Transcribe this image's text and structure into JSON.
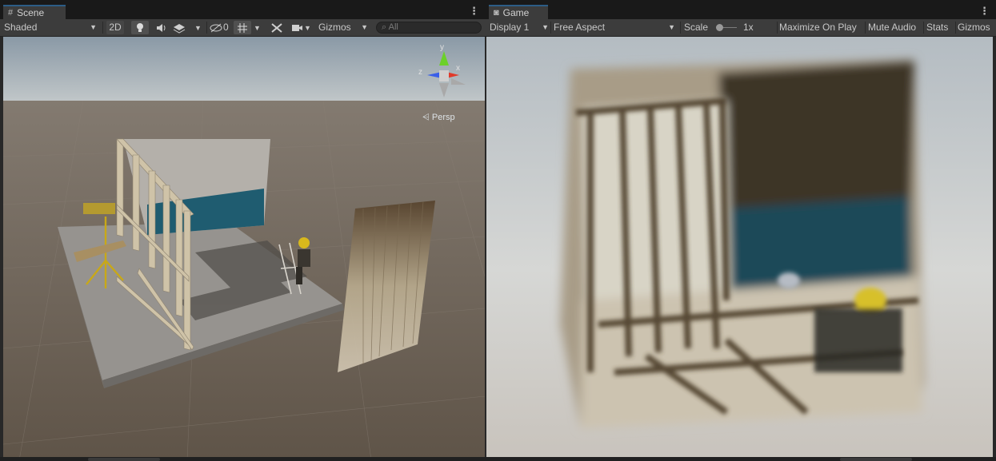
{
  "scene": {
    "tab_label": "Scene",
    "tab_icon": "grid-icon",
    "shading_mode": "Shaded",
    "mode_2d": "2D",
    "hidden_count": "0",
    "gizmos_label": "Gizmos",
    "search_placeholder": "All",
    "gizmo_axis_y": "y",
    "gizmo_axis_z": "z",
    "gizmo_axis_x": "x",
    "projection_label": "Persp"
  },
  "game": {
    "tab_label": "Game",
    "tab_icon": "gamepad-icon",
    "display": "Display 1",
    "aspect": "Free Aspect",
    "scale_label": "Scale",
    "scale_value": "1x",
    "scale_fraction": 0.0,
    "maximize_label": "Maximize On Play",
    "mute_label": "Mute Audio",
    "stats_label": "Stats",
    "gizmos_label": "Gizmos"
  },
  "colors": {
    "tab_accent": "#2c5d87",
    "toolbar_bg": "#3c3c3c",
    "axis_y": "#6cd02a",
    "axis_z": "#3a5fe8",
    "axis_x": "#e03a2a",
    "ground": "#6e6255",
    "sky": "#aab5bd"
  }
}
